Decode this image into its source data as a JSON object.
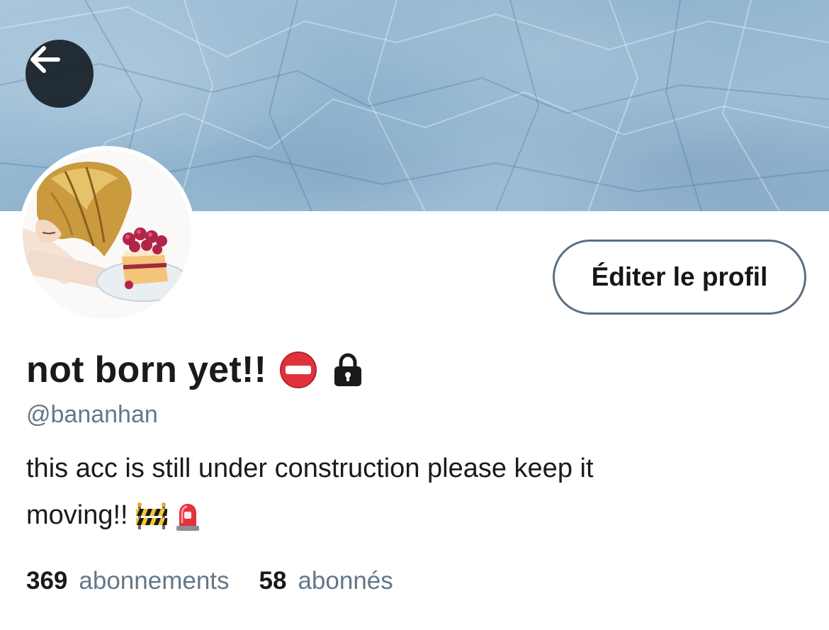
{
  "profile": {
    "display_name": "not born yet!!",
    "handle": "@bananhan",
    "bio_line1": "this acc is still under construction please keep it",
    "bio_line2": "moving!!",
    "edit_button_label": "Éditer le profil",
    "name_emojis": [
      "no-entry-icon",
      "lock-icon"
    ],
    "bio_emojis": [
      "construction-barrier-icon",
      "police-light-icon"
    ]
  },
  "stats": {
    "following_count": "369",
    "following_label": "abonnements",
    "followers_count": "58",
    "followers_label": "abonnés"
  },
  "colors": {
    "banner": "#9dbdd6",
    "secondary_text": "#657786",
    "button_border": "#5b6f80"
  }
}
